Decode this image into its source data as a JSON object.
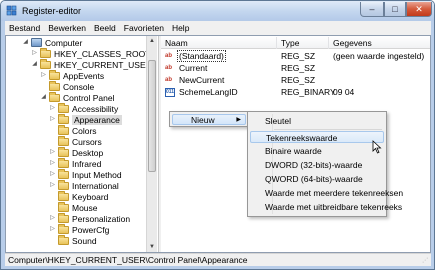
{
  "window": {
    "title": "Register-editor"
  },
  "menubar": [
    "Bestand",
    "Bewerken",
    "Beeld",
    "Favorieten",
    "Help"
  ],
  "tree": {
    "items": [
      {
        "label": "Computer",
        "icon": "computer-icon",
        "expander": "collapse"
      },
      {
        "label": "HKEY_CLASSES_ROOT",
        "icon": "folder-icon",
        "expander": "expand"
      },
      {
        "label": "HKEY_CURRENT_USER",
        "icon": "folder-icon",
        "expander": "collapse"
      },
      {
        "label": "AppEvents",
        "icon": "folder-icon",
        "expander": "expand"
      },
      {
        "label": "Console",
        "icon": "folder-icon",
        "expander": "none"
      },
      {
        "label": "Control Panel",
        "icon": "folder-icon",
        "expander": "collapse"
      },
      {
        "label": "Accessibility",
        "icon": "folder-icon",
        "expander": "expand"
      },
      {
        "label": "Appearance",
        "icon": "folder-icon",
        "expander": "expand",
        "selected": true
      },
      {
        "label": "Colors",
        "icon": "folder-icon",
        "expander": "none"
      },
      {
        "label": "Cursors",
        "icon": "folder-icon",
        "expander": "none"
      },
      {
        "label": "Desktop",
        "icon": "folder-icon",
        "expander": "expand"
      },
      {
        "label": "Infrared",
        "icon": "folder-icon",
        "expander": "expand"
      },
      {
        "label": "Input Method",
        "icon": "folder-icon",
        "expander": "expand"
      },
      {
        "label": "International",
        "icon": "folder-icon",
        "expander": "expand"
      },
      {
        "label": "Keyboard",
        "icon": "folder-icon",
        "expander": "none"
      },
      {
        "label": "Mouse",
        "icon": "folder-icon",
        "expander": "none"
      },
      {
        "label": "Personalization",
        "icon": "folder-icon",
        "expander": "expand"
      },
      {
        "label": "PowerCfg",
        "icon": "folder-icon",
        "expander": "expand"
      },
      {
        "label": "Sound",
        "icon": "folder-icon",
        "expander": "none"
      }
    ]
  },
  "values": {
    "columns": [
      "Naam",
      "Type",
      "Gegevens"
    ],
    "rows": [
      {
        "icon": "string-value-icon",
        "name": "(Standaard)",
        "type": "REG_SZ",
        "data": "(geen waarde ingesteld)"
      },
      {
        "icon": "string-value-icon",
        "name": "Current",
        "type": "REG_SZ",
        "data": ""
      },
      {
        "icon": "string-value-icon",
        "name": "NewCurrent",
        "type": "REG_SZ",
        "data": ""
      },
      {
        "icon": "binary-value-icon",
        "name": "SchemeLangID",
        "type": "REG_BINARY",
        "data": "09 04"
      }
    ]
  },
  "context_menu": {
    "main_item": "Nieuw",
    "submenu": [
      "Sleutel",
      "Tekenreekswaarde",
      "Binaire waarde",
      "DWORD (32-bits)-waarde",
      "QWORD (64-bits)-waarde",
      "Waarde met meerdere tekenreeksen",
      "Waarde met uitbreidbare tekenreeks"
    ],
    "hovered_item": "Tekenreekswaarde"
  },
  "statusbar": {
    "path": "Computer\\HKEY_CURRENT_USER\\Control Panel\\Appearance"
  },
  "colors": {
    "title_bar": "#c4d7ef",
    "close_button": "#c23a1b",
    "menu_highlight": "#dae9f9",
    "folder": "#e8c35a"
  }
}
